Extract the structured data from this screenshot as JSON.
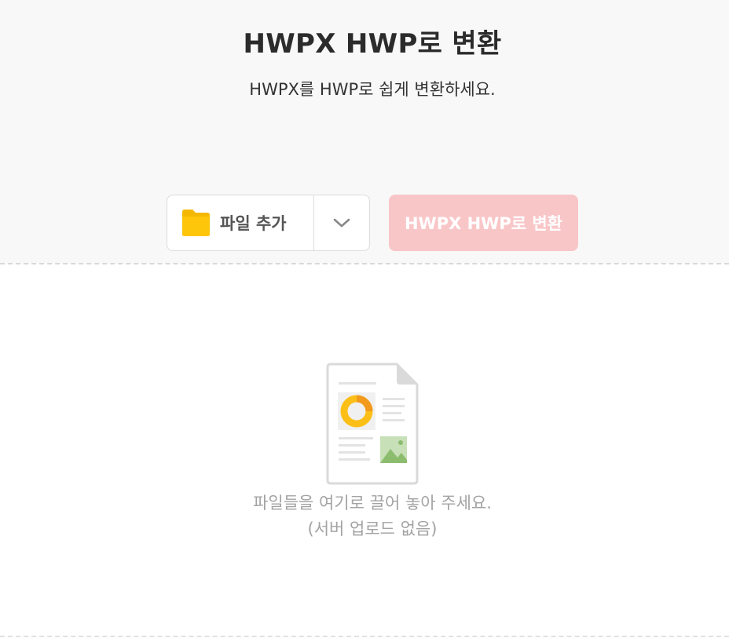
{
  "header": {
    "title": "HWPX HWP로 변환",
    "subtitle": "HWPX를 HWP로 쉽게 변환하세요."
  },
  "toolbar": {
    "add_files_label": "파일 추가",
    "add_files_icon": "folder-icon",
    "dropdown_icon": "chevron-down-icon",
    "convert_label": "HWPX HWP로 변환",
    "convert_color": "#f9c6c8",
    "folder_color": "#f5b800"
  },
  "dropzone": {
    "icon": "document-illustration-icon",
    "line1": "파일들을 여기로 끌어 놓아 주세요.",
    "line2": "(서버 업로드 없음)"
  }
}
